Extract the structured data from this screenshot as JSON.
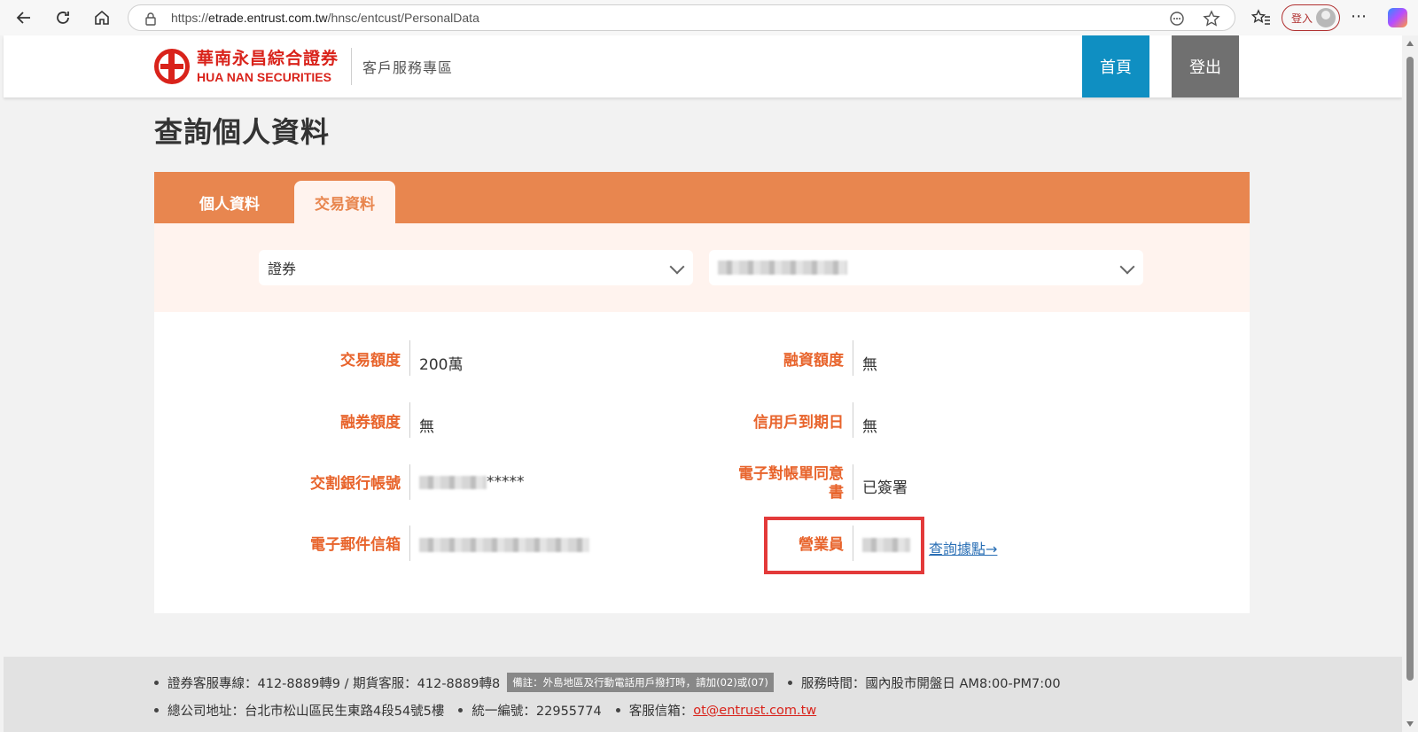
{
  "browser": {
    "url_prefix": "https://",
    "url_host": "etrade.entrust.com.tw",
    "url_path": "/hnsc/entcust/PersonalData",
    "login_label": "登入"
  },
  "header": {
    "logo_zh": "華南永昌綜合證券",
    "logo_en": "HUA NAN SECURITIES",
    "subtitle": "客戶服務專區",
    "home_label": "首頁",
    "logout_label": "登出"
  },
  "page": {
    "title": "查詢個人資料",
    "tabs": [
      {
        "label": "個人資料",
        "active": false
      },
      {
        "label": "交易資料",
        "active": true
      }
    ],
    "filters": {
      "category_value": "證券",
      "account_value": ""
    }
  },
  "data": {
    "rows": [
      {
        "label": "交易額度",
        "value": "200萬"
      },
      {
        "label": "融資額度",
        "value": "無"
      },
      {
        "label": "融券額度",
        "value": "無"
      },
      {
        "label": "信用戶到期日",
        "value": "無"
      },
      {
        "label": "交割銀行帳號",
        "value_suffix": "*****"
      },
      {
        "label_line1": "電子對帳單同意",
        "label_line2": "書",
        "value": "已簽署"
      },
      {
        "label": "電子郵件信箱",
        "value": ""
      },
      {
        "label": "營業員",
        "value": ""
      }
    ],
    "branch_link": "查詢據點→"
  },
  "footer": {
    "hotline": "證券客服專線：412-8889轉9 / 期貨客服：412-8889轉8",
    "note": "備註：外島地區及行動電話用戶撥打時，請加(02)或(07)",
    "hours": "服務時間：國內股市開盤日 AM8:00-PM7:00",
    "address": "總公司地址：台北市松山區民生東路4段54號5樓",
    "tax_id": "統一編號：22955774",
    "email_label": "客服信箱：",
    "email": "ot@entrust.com.tw"
  },
  "colors": {
    "accent": "#e8864f",
    "label": "#e8642c",
    "home_btn": "#0f8fc2",
    "logout_btn": "#707070",
    "highlight": "#e33a3a",
    "brand_red": "#d9231b"
  }
}
